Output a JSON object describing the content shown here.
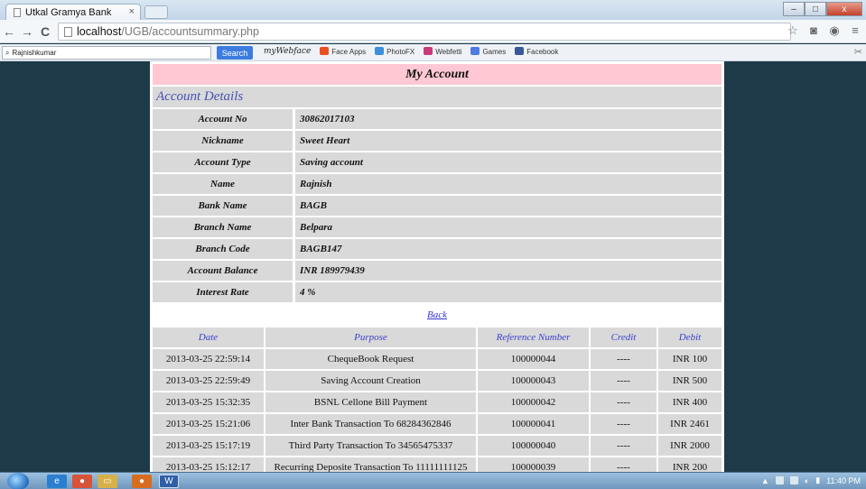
{
  "browser": {
    "tab_title": "Utkal Gramya Bank",
    "tab_close": "×",
    "url_host": "localhost",
    "url_path": "/UGB/accountsummary.php",
    "nav": {
      "back": "←",
      "forward": "→",
      "reload": "C"
    },
    "window_controls": {
      "minimize": "–",
      "maximize": "□",
      "close": "x"
    }
  },
  "toolbar": {
    "search_value": "Rajnishkumar",
    "search_button": "Search",
    "logo": "myWebface",
    "links": [
      {
        "label": "Face Apps",
        "color": "#e8501f"
      },
      {
        "label": "PhotoFX",
        "color": "#3e8fd8"
      },
      {
        "label": "Webfetti",
        "color": "#c83b7b"
      },
      {
        "label": "Games",
        "color": "#4f7be0"
      },
      {
        "label": "Facebook",
        "color": "#3b5998"
      }
    ]
  },
  "page": {
    "title": "My Account",
    "section_title": "Account Details",
    "details": [
      {
        "label": "Account No",
        "value": "30862017103"
      },
      {
        "label": "Nickname",
        "value": "Sweet Heart"
      },
      {
        "label": "Account Type",
        "value": "Saving account"
      },
      {
        "label": "Name",
        "value": "Rajnish"
      },
      {
        "label": "Bank Name",
        "value": "BAGB"
      },
      {
        "label": "Branch Name",
        "value": "Belpara"
      },
      {
        "label": "Branch Code",
        "value": "BAGB147"
      },
      {
        "label": "Account Balance",
        "value": "INR 189979439"
      },
      {
        "label": "Interest Rate",
        "value": "4 %"
      }
    ],
    "back_link": "Back",
    "transactions": {
      "headers": [
        "Date",
        "Purpose",
        "Reference Number",
        "Credit",
        "Debit"
      ],
      "rows": [
        [
          "2013-03-25 22:59:14",
          "ChequeBook Request",
          "100000044",
          "----",
          "INR 100"
        ],
        [
          "2013-03-25 22:59:49",
          "Saving Account Creation",
          "100000043",
          "----",
          "INR 500"
        ],
        [
          "2013-03-25 15:32:35",
          "BSNL Cellone Bill Payment",
          "100000042",
          "----",
          "INR 400"
        ],
        [
          "2013-03-25 15:21:06",
          "Inter Bank Transaction To 68284362846",
          "100000041",
          "----",
          "INR 2461"
        ],
        [
          "2013-03-25 15:17:19",
          "Third Party Transaction To 34565475337",
          "100000040",
          "----",
          "INR 2000"
        ],
        [
          "2013-03-25 15:12:17",
          "Recurring Deposite Transaction To 11111111125",
          "100000039",
          "----",
          "INR 200"
        ]
      ]
    }
  },
  "taskbar": {
    "clock": "11:40 PM"
  }
}
